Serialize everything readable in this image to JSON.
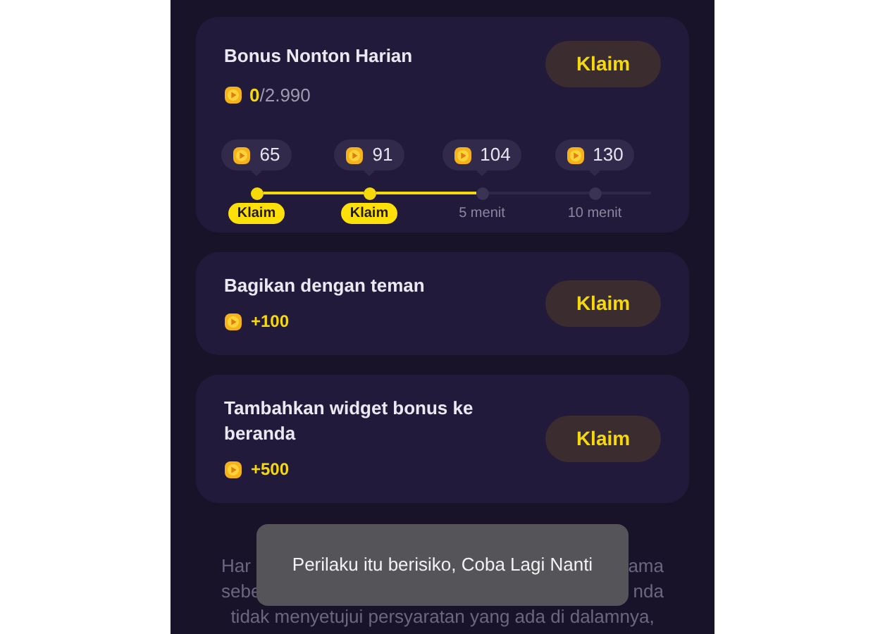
{
  "daily_bonus": {
    "title": "Bonus Nonton Harian",
    "earned": "0",
    "total": "/2.990",
    "button": "Klaim",
    "milestones": [
      {
        "amount": "65",
        "claimable": true,
        "label": "Klaim"
      },
      {
        "amount": "91",
        "claimable": true,
        "label": "Klaim"
      },
      {
        "amount": "104",
        "claimable": false,
        "label": "5 menit"
      },
      {
        "amount": "130",
        "claimable": false,
        "label": "10 menit"
      }
    ]
  },
  "tasks": [
    {
      "title": "Bagikan dengan teman",
      "reward": "+100",
      "button": "Klaim"
    },
    {
      "title": "Tambahkan widget bonus ke beranda",
      "reward": "+500",
      "button": "Klaim"
    }
  ],
  "terms_fragments": [
    [
      "Har",
      "ama"
    ],
    [
      "sebe",
      "nda"
    ],
    [
      "tidak menyetujui persyaratan yang ada di dalamnya,"
    ]
  ],
  "toast": "Perilaku itu berisiko, Coba Lagi Nanti"
}
